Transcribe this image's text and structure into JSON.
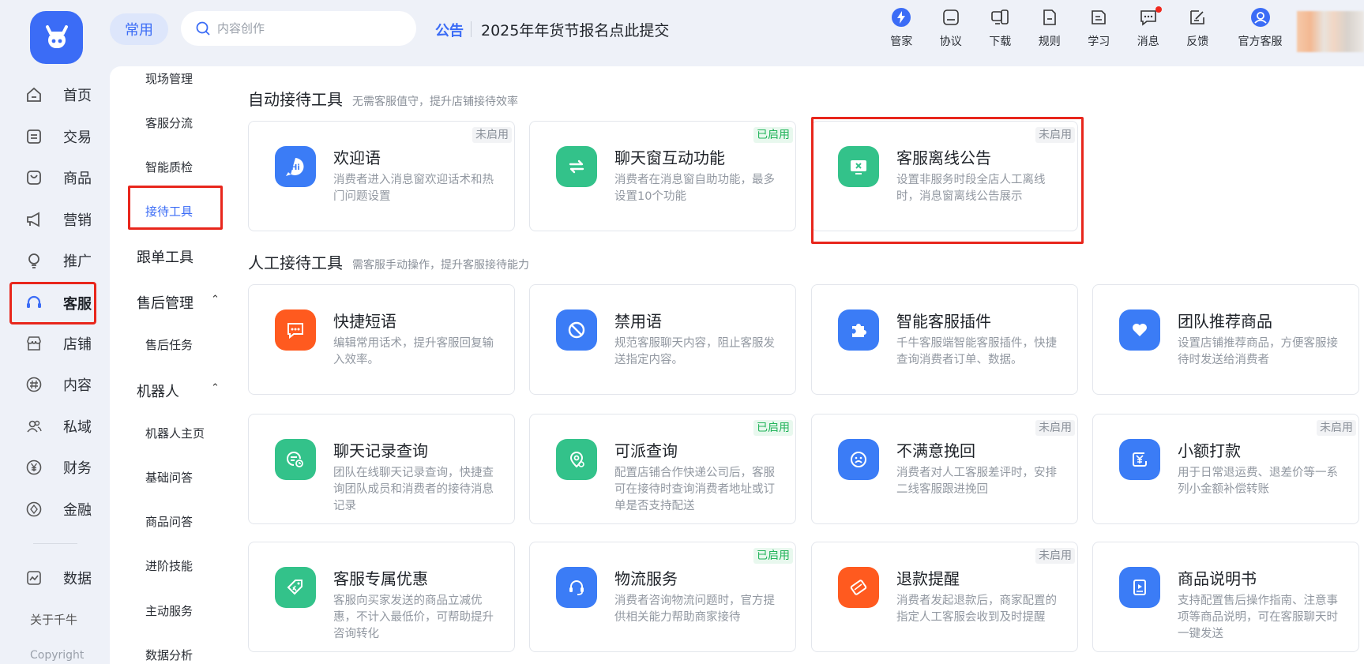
{
  "logo": {
    "icon": "cow-logo-icon",
    "color": "#3b6cf6"
  },
  "sidebar": {
    "items": [
      {
        "label": "首页",
        "icon": "home-icon"
      },
      {
        "label": "交易",
        "icon": "order-icon"
      },
      {
        "label": "商品",
        "icon": "bag-icon"
      },
      {
        "label": "营销",
        "icon": "megaphone-icon"
      },
      {
        "label": "推广",
        "icon": "bulb-icon"
      },
      {
        "label": "客服",
        "icon": "headset-icon",
        "active": true
      },
      {
        "label": "店铺",
        "icon": "shop-icon"
      },
      {
        "label": "内容",
        "icon": "hash-icon"
      },
      {
        "label": "私域",
        "icon": "users-icon"
      },
      {
        "label": "财务",
        "icon": "yen-icon"
      },
      {
        "label": "金融",
        "icon": "finance-icon"
      }
    ],
    "data_label": "数据",
    "about": "关于千牛",
    "copyright": "Copyright"
  },
  "topbar": {
    "pill": "常用",
    "search_placeholder": "内容创作",
    "notice_tag": "公告",
    "notice_text": "2025年年货节报名点此提交",
    "icons": [
      {
        "label": "管家",
        "icon": "butler-icon"
      },
      {
        "label": "协议",
        "icon": "protocol-icon"
      },
      {
        "label": "下载",
        "icon": "download-device-icon"
      },
      {
        "label": "规则",
        "icon": "rules-icon"
      },
      {
        "label": "学习",
        "icon": "learn-icon"
      },
      {
        "label": "消息",
        "icon": "message-icon",
        "unread": true
      },
      {
        "label": "反馈",
        "icon": "feedback-icon"
      },
      {
        "label": "官方客服",
        "icon": "official-service-icon"
      }
    ]
  },
  "submenu": {
    "items": {
      "onsite": "现场管理",
      "routing": "客服分流",
      "qc": "智能质检",
      "tools": "接待工具",
      "followup": "跟单工具",
      "aftersale_group": "售后管理",
      "aftersale_task": "售后任务",
      "robot_group": "机器人",
      "robot_home": "机器人主页",
      "basic_qa": "基础问答",
      "goods_qa": "商品问答",
      "advanced": "进阶技能",
      "active": "主动服务",
      "analysis": "数据分析"
    }
  },
  "auto_section": {
    "title": "自动接待工具",
    "subtitle": "无需客服值守，提升店铺接待效率",
    "cards": [
      {
        "title": "欢迎语",
        "desc": "消费者进入消息窗欢迎话术和热门问题设置",
        "status": "未启用",
        "icon": "hi-bubble-icon",
        "color": "blue"
      },
      {
        "title": "聊天窗互动功能",
        "desc": "消费者在消息窗自助功能，最多设置10个功能",
        "status": "已启用",
        "icon": "swap-icon",
        "color": "green"
      },
      {
        "title": "客服离线公告",
        "desc": "设置非服务时段全店人工离线时，消息窗离线公告展示",
        "status": "未启用",
        "icon": "monitor-off-icon",
        "color": "green"
      }
    ]
  },
  "manual_section": {
    "title": "人工接待工具",
    "subtitle": "需客服手动操作，提升客服接待能力",
    "cards": [
      {
        "title": "快捷短语",
        "desc": "编辑常用话术，提升客服回复输入效率。",
        "status": "",
        "icon": "chat-dots-icon",
        "color": "orange"
      },
      {
        "title": "禁用语",
        "desc": "规范客服聊天内容，阻止客服发送指定内容。",
        "status": "",
        "icon": "forbidden-icon",
        "color": "blue"
      },
      {
        "title": "智能客服插件",
        "desc": "千牛客服端智能客服插件，快捷查询消费者订单、数据。",
        "status": "",
        "icon": "puzzle-icon",
        "color": "blue"
      },
      {
        "title": "团队推荐商品",
        "desc": "设置店铺推荐商品，方便客服接待时发送给消费者",
        "status": "",
        "icon": "heart-icon",
        "color": "blue"
      },
      {
        "title": "聊天记录查询",
        "desc": "团队在线聊天记录查询，快捷查询团队成员和消费者的接待消息记录",
        "status": "",
        "icon": "chat-history-icon",
        "color": "green"
      },
      {
        "title": "可派查询",
        "desc": "配置店铺合作快递公司后，客服可在接待时查询消费者地址或订单是否支持配送",
        "status": "已启用",
        "icon": "location-search-icon",
        "color": "green"
      },
      {
        "title": "不满意挽回",
        "desc": "消费者对人工客服差评时，安排二线客服跟进挽回",
        "status": "未启用",
        "icon": "sad-face-icon",
        "color": "blue"
      },
      {
        "title": "小额打款",
        "desc": "用于日常退运费、退差价等一系列小金额补偿转账",
        "status": "未启用",
        "icon": "yen-transfer-icon",
        "color": "blue"
      },
      {
        "title": "客服专属优惠",
        "desc": "客服向买家发送的商品立减优惠，不计入最低价，可帮助提升咨询转化",
        "status": "",
        "icon": "coupon-tag-icon",
        "color": "green"
      },
      {
        "title": "物流服务",
        "desc": "消费者咨询物流问题时，官方提供相关能力帮助商家接待",
        "status": "已启用",
        "icon": "headset-service-icon",
        "color": "blue"
      },
      {
        "title": "退款提醒",
        "desc": "消费者发起退款后，商家配置的指定人工客服会收到及时提醒",
        "status": "未启用",
        "icon": "refund-card-icon",
        "color": "orange"
      },
      {
        "title": "商品说明书",
        "desc": "支持配置售后操作指南、注意事项等商品说明，可在客服聊天时一键发送",
        "status": "",
        "icon": "manual-play-icon",
        "color": "blue"
      }
    ]
  }
}
